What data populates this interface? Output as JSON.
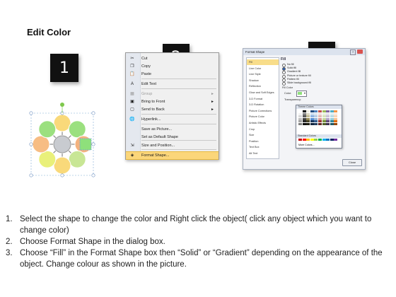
{
  "title": "Edit Color",
  "badges": [
    "1",
    "2",
    "3"
  ],
  "diagram": {
    "center_color": "#c8cbd0",
    "ring_colors": [
      "#f9d97a",
      "#9be07f",
      "#f3b27f",
      "#c8e695",
      "#f9d97a",
      "#e9f07a",
      "#f7bd84",
      "#9be07f"
    ],
    "selected_color": "#8ee07b",
    "handle_color": "#7ec84c"
  },
  "context_menu": {
    "items": [
      {
        "label": "Cut",
        "icon": "scissors-icon",
        "glyph": "✂",
        "disabled": false
      },
      {
        "label": "Copy",
        "icon": "copy-icon",
        "glyph": "❐",
        "disabled": false
      },
      {
        "label": "Paste",
        "icon": "paste-icon",
        "glyph": "📋",
        "disabled": false
      },
      {
        "label": "Edit Text",
        "icon": "edit-text-icon",
        "glyph": "A",
        "disabled": false
      },
      {
        "label": "Group",
        "icon": "group-icon",
        "glyph": "▦",
        "disabled": true,
        "submenu": true
      },
      {
        "label": "Bring to Front",
        "icon": "bring-front-icon",
        "glyph": "▣",
        "disabled": false,
        "submenu": true
      },
      {
        "label": "Send to Back",
        "icon": "send-back-icon",
        "glyph": "▢",
        "disabled": false,
        "submenu": true
      },
      {
        "label": "Hyperlink...",
        "icon": "hyperlink-icon",
        "glyph": "🌐",
        "disabled": false
      },
      {
        "label": "Save as Picture...",
        "icon": "",
        "glyph": "",
        "disabled": false
      },
      {
        "label": "Set as Default Shape",
        "icon": "",
        "glyph": "",
        "disabled": false
      },
      {
        "label": "Size and Position...",
        "icon": "size-position-icon",
        "glyph": "⇲",
        "disabled": false
      },
      {
        "label": "Format Shape...",
        "icon": "format-shape-icon",
        "glyph": "◈",
        "disabled": false,
        "highlighted": true
      }
    ]
  },
  "dialog": {
    "title": "Format Shape",
    "help": "?",
    "categories": [
      "Fill",
      "Line Color",
      "Line Style",
      "Shadow",
      "Reflection",
      "Glow and Soft Edges",
      "3-D Format",
      "3-D Rotation",
      "Picture Corrections",
      "Picture Color",
      "Artistic Effects",
      "Crop",
      "Size",
      "Position",
      "Text Box",
      "Alt Text"
    ],
    "selected_category": "Fill",
    "pane_title": "Fill",
    "options": [
      "No fill",
      "Solid fill",
      "Gradient fill",
      "Picture or texture fill",
      "Pattern fill",
      "Slide background fill"
    ],
    "selected_option": "Solid fill",
    "fill_color_label": "Fill Color",
    "color_label": "Color:",
    "transparency_label": "Transparency:",
    "close_label": "Close"
  },
  "palette": {
    "theme_label": "Theme Colors",
    "standard_label": "Standard Colors",
    "more_label": "More Colors...",
    "theme_rows": [
      [
        "#ffffff",
        "#000000",
        "#eeece1",
        "#1f497d",
        "#4f81bd",
        "#c0504d",
        "#9bbb59",
        "#8064a2",
        "#4bacc6",
        "#f79646"
      ],
      [
        "#f2f2f2",
        "#7f7f7f",
        "#ddd9c3",
        "#c6d9f0",
        "#dbe5f1",
        "#f2dcdb",
        "#ebf1dd",
        "#e5e0ec",
        "#dbeef3",
        "#fdeada"
      ],
      [
        "#d8d8d8",
        "#595959",
        "#c4bd97",
        "#8db3e2",
        "#b8cce4",
        "#e5b9b7",
        "#d7e3bc",
        "#ccc1d9",
        "#b7dde8",
        "#fbd5b5"
      ],
      [
        "#bfbfbf",
        "#3f3f3f",
        "#938953",
        "#548dd4",
        "#95b3d7",
        "#d99694",
        "#c3d69b",
        "#b2a2c7",
        "#92cddc",
        "#fac08f"
      ],
      [
        "#a5a5a5",
        "#262626",
        "#494429",
        "#17365d",
        "#366092",
        "#953734",
        "#76923c",
        "#5f497a",
        "#31859b",
        "#e36c09"
      ],
      [
        "#7f7f7f",
        "#0c0c0c",
        "#1d1b10",
        "#0f243e",
        "#244061",
        "#632423",
        "#4f6128",
        "#3f3151",
        "#205867",
        "#974806"
      ]
    ],
    "standard_row": [
      "#c00000",
      "#ff0000",
      "#ffc000",
      "#ffff00",
      "#92d050",
      "#00b050",
      "#00b0f0",
      "#0070c0",
      "#002060",
      "#7030a0"
    ]
  },
  "steps": [
    {
      "n": "1.",
      "text": "Select the shape to change the color and Right click the object( click any object which you want to change color)"
    },
    {
      "n": "2.",
      "text": "Choose Format Shape in the dialog box."
    },
    {
      "n": "3.",
      "text": "Choose “Fill” in the Format Shape box then “Solid” or “Gradient” depending on the appearance of the object. Change colour as shown in the picture."
    }
  ]
}
